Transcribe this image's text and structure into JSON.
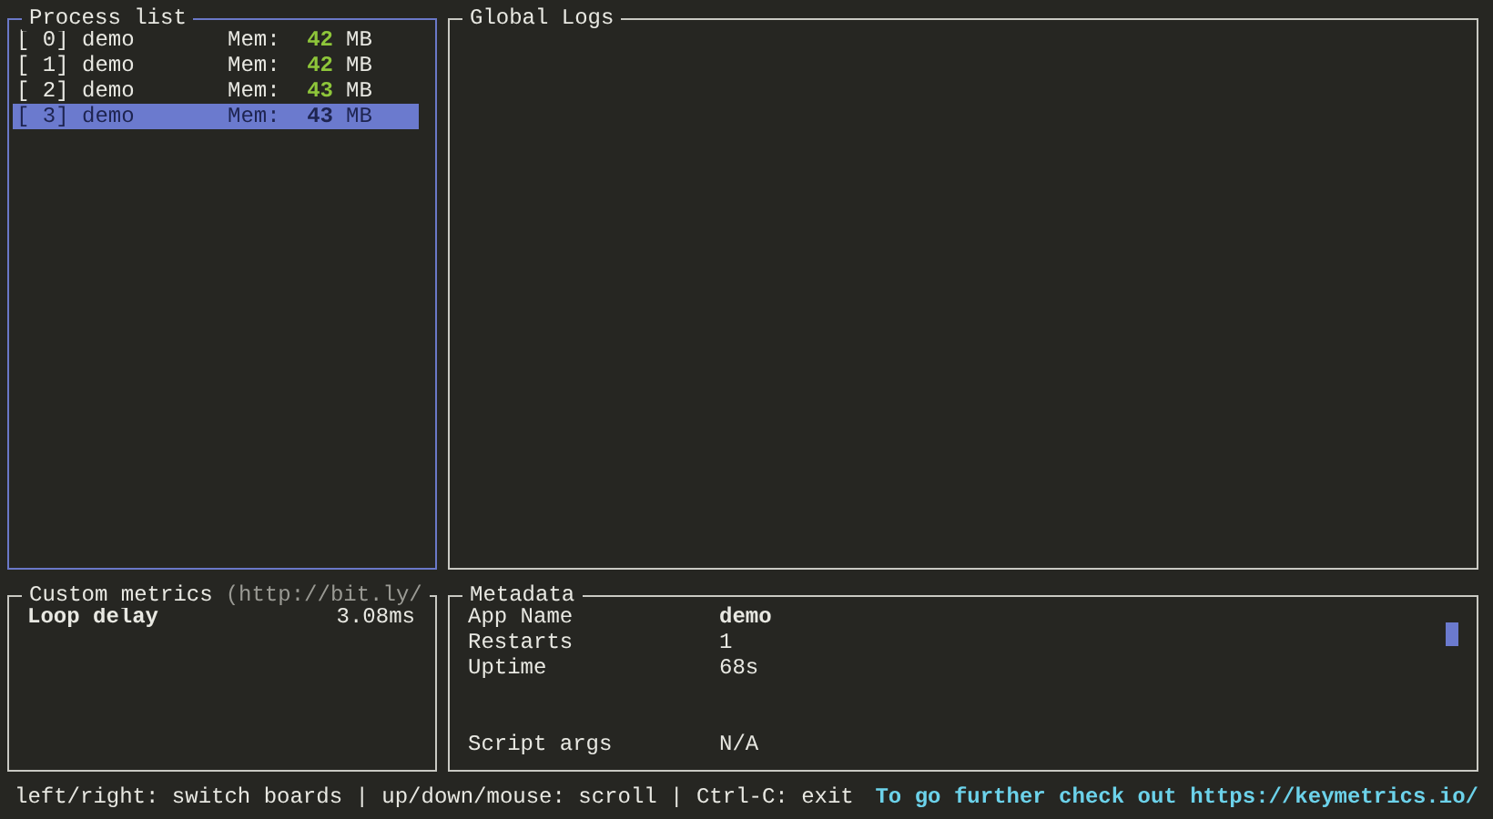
{
  "process_list": {
    "title": "Process list",
    "focused": true,
    "processes": [
      {
        "index": "[ 0]",
        "name": "demo",
        "mem_label": "Mem:",
        "mem": "42",
        "unit": "MB",
        "selected": false
      },
      {
        "index": "[ 1]",
        "name": "demo",
        "mem_label": "Mem:",
        "mem": "42",
        "unit": "MB",
        "selected": false
      },
      {
        "index": "[ 2]",
        "name": "demo",
        "mem_label": "Mem:",
        "mem": "43",
        "unit": "MB",
        "selected": false
      },
      {
        "index": "[ 3]",
        "name": "demo",
        "mem_label": "Mem:",
        "mem": "43",
        "unit": "MB",
        "selected": true
      }
    ]
  },
  "global_logs": {
    "title": "Global Logs",
    "focused": false
  },
  "custom_metrics": {
    "title": "Custom metrics",
    "title_note": "(http://bit.ly/",
    "focused": false,
    "metrics": [
      {
        "name": "Loop delay",
        "value": "3.08ms"
      }
    ]
  },
  "metadata": {
    "title": "Metadata",
    "focused": false,
    "rows": [
      {
        "key": "App Name",
        "value": "demo",
        "bold": true
      },
      {
        "key": "Restarts",
        "value": "1",
        "bold": false
      },
      {
        "key": "Uptime",
        "value": "68s",
        "bold": false
      },
      {
        "key": "Script args",
        "value": "N/A",
        "bold": false
      }
    ]
  },
  "status_bar": {
    "help": "left/right: switch boards | up/down/mouse: scroll | Ctrl-C: exit",
    "link": "To go further check out https://keymetrics.io/"
  }
}
